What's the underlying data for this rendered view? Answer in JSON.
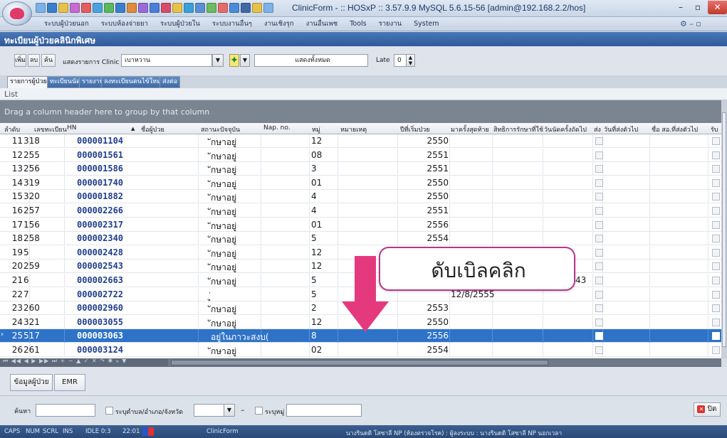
{
  "window": {
    "title": "ClinicForm - :: HOSxP :: 3.57.9.9 MySQL 5.6.15-56 [admin@192.168.2.2/hos]",
    "minimize": "–",
    "maximize": "▫",
    "close": "✕"
  },
  "menu": {
    "items": [
      "ระบบผู้ป่วยนอก",
      "ระบบห้องจ่ายยา",
      "ระบบผู้ป่วยใน",
      "ระบบงานอื่นๆ",
      "งานเชิงรุก",
      "งานอื่นเพช",
      "Tools",
      "รายงาน",
      "System"
    ],
    "right_icons": "⚙ – ▫"
  },
  "section_title": "ทะเบียนผู้ป่วยคลินิกพิเศษ",
  "toolbar": {
    "add_label": "เพิ่ม",
    "delete_label": "ลบ",
    "search_label": "ค้น",
    "clinic_label": "แสดงรายการ Clinic",
    "clinic_value": "เบาหวาน",
    "show_all_value": "แสดงทั้งหมด",
    "late_label": "Late",
    "late_value": "0"
  },
  "tabs": [
    {
      "label": "รายการผู้ป่วย",
      "active": true
    },
    {
      "label": "ทะเบียนนัด",
      "active": false
    },
    {
      "label": "รายงาน",
      "active": false
    },
    {
      "label": "ลงทะเบียนคนไข้ใหม่",
      "active": false
    },
    {
      "label": "ส่งต่อ",
      "active": false
    }
  ],
  "list": {
    "label": "List",
    "group_hint": "Drag a column header here to group by that column",
    "columns": [
      "ลำดับ",
      "เลขทะเบียน",
      "HN",
      "▲",
      "ชื่อผู้ป่วย",
      "สถานะปัจจุบัน",
      "Nap. no.",
      "หมู่",
      "หมายเหตุ",
      "ปีที่เริ่มป่วย",
      "มาครั้งสุดท้าย",
      "สิทธิการรักษาที่ใช้",
      "วันนัดครั้งถัดไป",
      "ส่ง",
      "วันที่ส่งตัวไป",
      "ชื่อ สอ.ที่ส่งตัวไป",
      "รับ"
    ],
    "rows": [
      {
        "no": "11",
        "reg": "318",
        "hn": "000001104",
        "status": "ักษาอยู่",
        "moo": "12",
        "year": "2550",
        "last": "",
        "selected": false
      },
      {
        "no": "12",
        "reg": "255",
        "hn": "000001561",
        "status": "ักษาอยู่",
        "moo": "08",
        "year": "2551",
        "last": "",
        "selected": false
      },
      {
        "no": "13",
        "reg": "256",
        "hn": "000001586",
        "status": "ักษาอยู่",
        "moo": "3",
        "year": "2551",
        "last": "",
        "selected": false
      },
      {
        "no": "14",
        "reg": "319",
        "hn": "000001740",
        "status": "ักษาอยู่",
        "moo": "01",
        "year": "2550",
        "last": "",
        "selected": false
      },
      {
        "no": "15",
        "reg": "320",
        "hn": "000001882",
        "status": "ักษาอยู่",
        "moo": "4",
        "year": "2550",
        "last": "",
        "selected": false
      },
      {
        "no": "16",
        "reg": "257",
        "hn": "000002266",
        "status": "ักษาอยู่",
        "moo": "4",
        "year": "2551",
        "last": "",
        "selected": false
      },
      {
        "no": "17",
        "reg": "156",
        "hn": "000002317",
        "status": "ักษาอยู่",
        "moo": "01",
        "year": "2556",
        "last": "",
        "selected": false
      },
      {
        "no": "18",
        "reg": "258",
        "hn": "000002340",
        "status": "ักษาอยู่",
        "moo": "5",
        "year": "2554",
        "last": "",
        "selected": false
      },
      {
        "no": "19",
        "reg": "5",
        "hn": "000002428",
        "status": "ักษาอยู่",
        "moo": "12",
        "year": "",
        "last": "",
        "selected": false
      },
      {
        "no": "20",
        "reg": "259",
        "hn": "000002543",
        "status": "ักษาอยู่",
        "moo": "12",
        "year": "",
        "last": "",
        "selected": false
      },
      {
        "no": "21",
        "reg": "6",
        "hn": "000002663",
        "status": "ักษาอยู่",
        "moo": "5",
        "year": "",
        "last": "",
        "selected": false
      },
      {
        "no": "22",
        "reg": "7",
        "hn": "000002722",
        "status": "ู่",
        "moo": "5",
        "year": "",
        "last": "12/8/2555",
        "selected": false
      },
      {
        "no": "23",
        "reg": "260",
        "hn": "000002960",
        "status": "ักษาอยู่",
        "moo": "2",
        "year": "2553",
        "last": "",
        "selected": false
      },
      {
        "no": "24",
        "reg": "321",
        "hn": "000003055",
        "status": "ักษาอยู่",
        "moo": "12",
        "year": "2550",
        "last": "",
        "selected": false
      },
      {
        "no": "25",
        "reg": "517",
        "hn": "000003063",
        "status": "อยู่ในภาวะสงบ(",
        "moo": "8",
        "year": "2556",
        "last": "",
        "selected": true
      },
      {
        "no": "26",
        "reg": "261",
        "hn": "000003124",
        "status": "ักษาอยู่",
        "moo": "02",
        "year": "2554",
        "last": "",
        "selected": false
      }
    ],
    "partial_cell": "43"
  },
  "navigator": "⏮ ◀◀ ◀ ▶ ▶▶ ⏭ + − ▲ ✓ ✕ ↷ ✱ ⁎ ▼",
  "bottom_buttons": {
    "patient_info": "ข้อมูลผู้ป่วย",
    "emr": "EMR"
  },
  "search": {
    "label": "ค้นหา",
    "address_check_label": "ระบุตำบล/อำเภอ/จังหวัด",
    "dash": "–",
    "moo_check_label": "ระบุหมู่",
    "close_label": "ปิด"
  },
  "status_bar": {
    "caps": "CAPS",
    "num": "NUM",
    "scrl": "SCRL",
    "ins": "INS",
    "idle": "IDLE 0:3",
    "time": "22:01",
    "form": "ClinicForm",
    "user": "นางรินดดิ โสซาลี NP (ห้องตรวจโรค) : ผู้ลงระบบ : นางรินดดิ โสซาลี NP นอกเวลา"
  },
  "overlay": {
    "callout_text": "ดับเบิลคลิก"
  },
  "colors": {
    "accent": "#2e73c8",
    "header_blue": "#3a66a8",
    "callout_border": "#b7378b",
    "arrow": "#e5397e"
  }
}
